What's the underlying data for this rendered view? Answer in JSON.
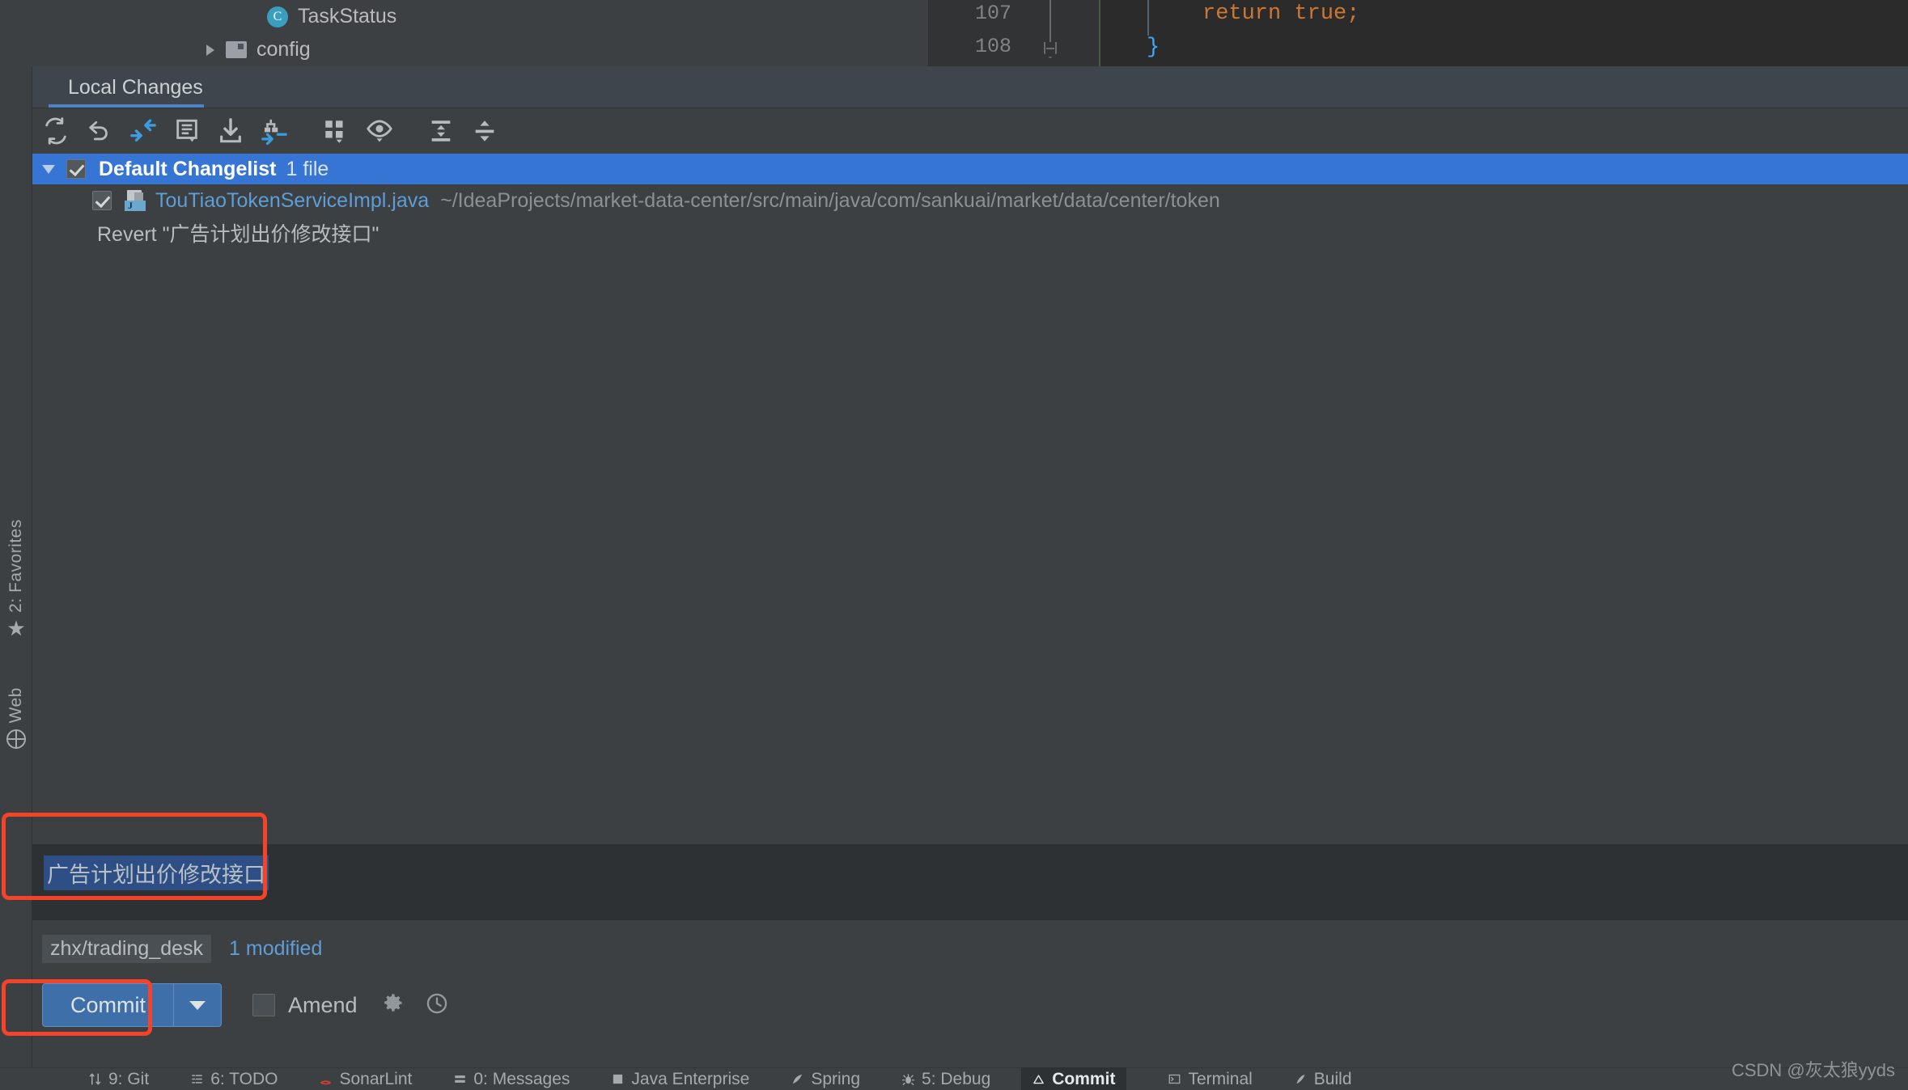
{
  "editor": {
    "tree": [
      {
        "label": "TaskStatus",
        "icon": "class-icon",
        "icon_letter": "C"
      },
      {
        "label": "config",
        "icon": "folder-icon"
      }
    ],
    "line_numbers": [
      "107",
      "108"
    ],
    "code_lines": [
      "return true;",
      "}"
    ],
    "colors": {
      "keyword": "#cc7832",
      "brace": "#3dabff",
      "editor_bg": "#2b2b2b"
    }
  },
  "tabbar": {
    "active_tab": "Local Changes",
    "accent": "#4b82c8"
  },
  "toolbar": {
    "buttons": [
      {
        "name": "refresh-icon",
        "title": "Refresh"
      },
      {
        "name": "rollback-icon",
        "title": "Rollback"
      },
      {
        "name": "commit-icon",
        "title": "Commit"
      },
      {
        "name": "show-diff-icon",
        "title": "Show Diff"
      },
      {
        "name": "update-icon",
        "title": "Update Project"
      },
      {
        "name": "shelve-icon",
        "title": "Shelve Silently"
      },
      {
        "name": "group-by-icon",
        "title": "Group By"
      },
      {
        "name": "preview-icon",
        "title": "Preview Diff"
      },
      {
        "name": "expand-all-icon",
        "title": "Expand All"
      },
      {
        "name": "collapse-all-icon",
        "title": "Collapse All"
      }
    ]
  },
  "changes": {
    "changelist": {
      "name": "Default Changelist",
      "count": "1 file",
      "checked": true,
      "expanded": true
    },
    "file": {
      "name": "TouTiaoTokenServiceImpl.java",
      "path": "~/IdeaProjects/market-data-center/src/main/java/com/sankuai/market/data/center/token",
      "checked": true
    },
    "revert_entry": "Revert \"广告计划出价修改接口\""
  },
  "commit_message": {
    "value": "广告计划出价修改接口",
    "selected": true
  },
  "commit_bar": {
    "branch": "zhx/trading_desk",
    "modified": "1 modified",
    "commit_label": "Commit",
    "amend_label": "Amend",
    "amend_checked": false,
    "gear_icon": "gear-icon",
    "history_icon": "clock-icon"
  },
  "left_strip": [
    {
      "label": "2: Favorites",
      "icon": "star-icon"
    },
    {
      "label": "Web",
      "icon": "globe-icon"
    }
  ],
  "status_bar": {
    "items": [
      {
        "label": "9: Git",
        "icon": "git-icon",
        "active": false
      },
      {
        "label": "6: TODO",
        "icon": "todo-icon",
        "active": false
      },
      {
        "label": "SonarLint",
        "icon": "sonarlint-icon",
        "active": false
      },
      {
        "label": "0: Messages",
        "icon": "messages-icon",
        "active": false
      },
      {
        "label": "Java Enterprise",
        "icon": "java-ee-icon",
        "active": false
      },
      {
        "label": "Spring",
        "icon": "spring-icon",
        "active": false
      },
      {
        "label": "5: Debug",
        "icon": "debug-icon",
        "active": false
      },
      {
        "label": "Commit",
        "icon": "commit-tool-icon",
        "active": true
      },
      {
        "label": "Terminal",
        "icon": "terminal-icon",
        "active": false
      },
      {
        "label": "Build",
        "icon": "build-icon",
        "active": false
      }
    ]
  },
  "watermark": "CSDN @灰太狼yyds",
  "annotations": {
    "color": "#f44328"
  }
}
